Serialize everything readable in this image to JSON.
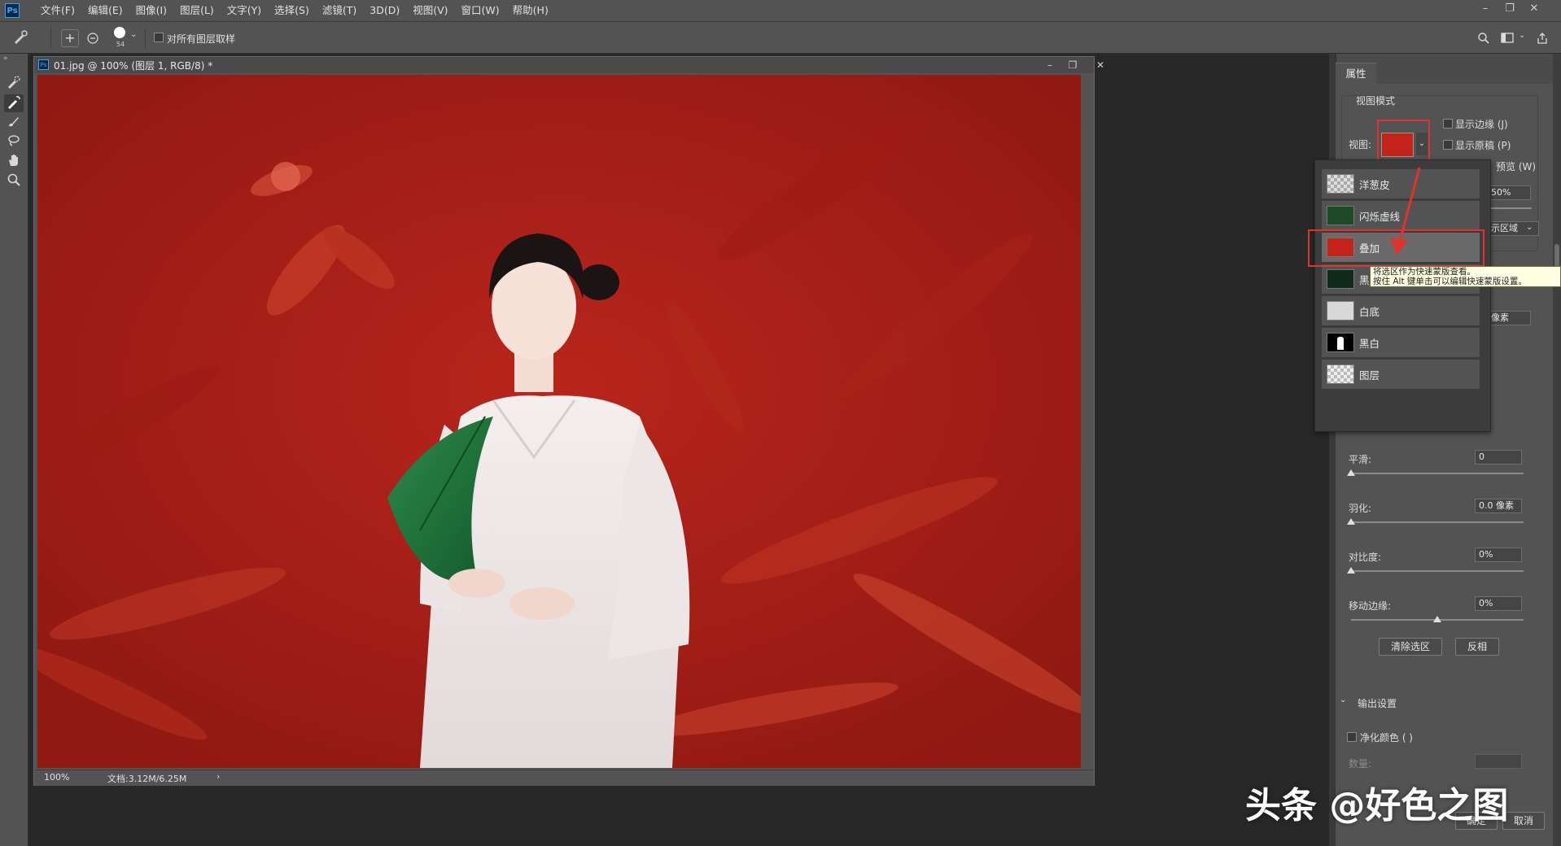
{
  "app": {
    "logo": "Ps"
  },
  "menubar": {
    "items": [
      "文件(F)",
      "编辑(E)",
      "图像(I)",
      "图层(L)",
      "文字(Y)",
      "选择(S)",
      "滤镜(T)",
      "3D(D)",
      "视图(V)",
      "窗口(W)",
      "帮助(H)"
    ],
    "window_controls": {
      "minimize": "–",
      "restore": "❐",
      "close": "✕"
    }
  },
  "options_bar": {
    "brush_size": "54",
    "sample_all_layers_label": "对所有图层取样",
    "sample_all_layers_checked": false
  },
  "document": {
    "title": "01.jpg @ 100% (图层 1, RGB/8) *",
    "zoom": "100%",
    "doc_info": "文档:3.12M/6.25M",
    "status_arrow": "›"
  },
  "properties_panel": {
    "tab_label": "属性",
    "view_mode_section": "视图模式",
    "view_label": "视图:",
    "show_edge_label": "显示边缘 (J)",
    "show_original_label": "显示原稿 (P)",
    "preview_label_partial": "预览 (W)",
    "opacity_partial": "50%",
    "region_partial": "示区域",
    "pixels_partial": "像素",
    "smooth_label": "平滑:",
    "smooth_value": "0",
    "smooth_level": 0,
    "feather_label": "羽化:",
    "feather_value": "0.0 像素",
    "feather_level": 0,
    "contrast_label": "对比度:",
    "contrast_value": "0%",
    "contrast_level": 0,
    "shift_edge_label": "移动边缘:",
    "shift_edge_value": "0%",
    "shift_edge_level": 0.5,
    "clear_selection_btn": "清除选区",
    "invert_btn": "反相",
    "output_settings_label": "输出设置",
    "decontaminate_label": "净化颜色 ( )",
    "amount_label": "数量:",
    "ok_btn": "确定",
    "cancel_btn": "取消"
  },
  "view_popup": {
    "items": [
      {
        "label": "洋葱皮",
        "thumb": "onion-skin"
      },
      {
        "label": "闪烁虚线",
        "thumb": "marching-ants"
      },
      {
        "label": "叠加",
        "thumb": "overlay",
        "highlighted": true
      },
      {
        "label": "黑",
        "thumb": "on-black"
      },
      {
        "label": "白底",
        "thumb": "on-white"
      },
      {
        "label": "黑白",
        "thumb": "black-white"
      },
      {
        "label": "图层",
        "thumb": "on-layers"
      }
    ],
    "tooltip_line1": "将选区作为快速蒙版查看。",
    "tooltip_line2": "按住 Alt 键单击可以编辑快速蒙版设置。"
  },
  "watermark": "头条 @好色之图",
  "colors": {
    "overlay_red": "#a8201a",
    "highlight_red": "#e0332e",
    "panel": "#535353"
  }
}
